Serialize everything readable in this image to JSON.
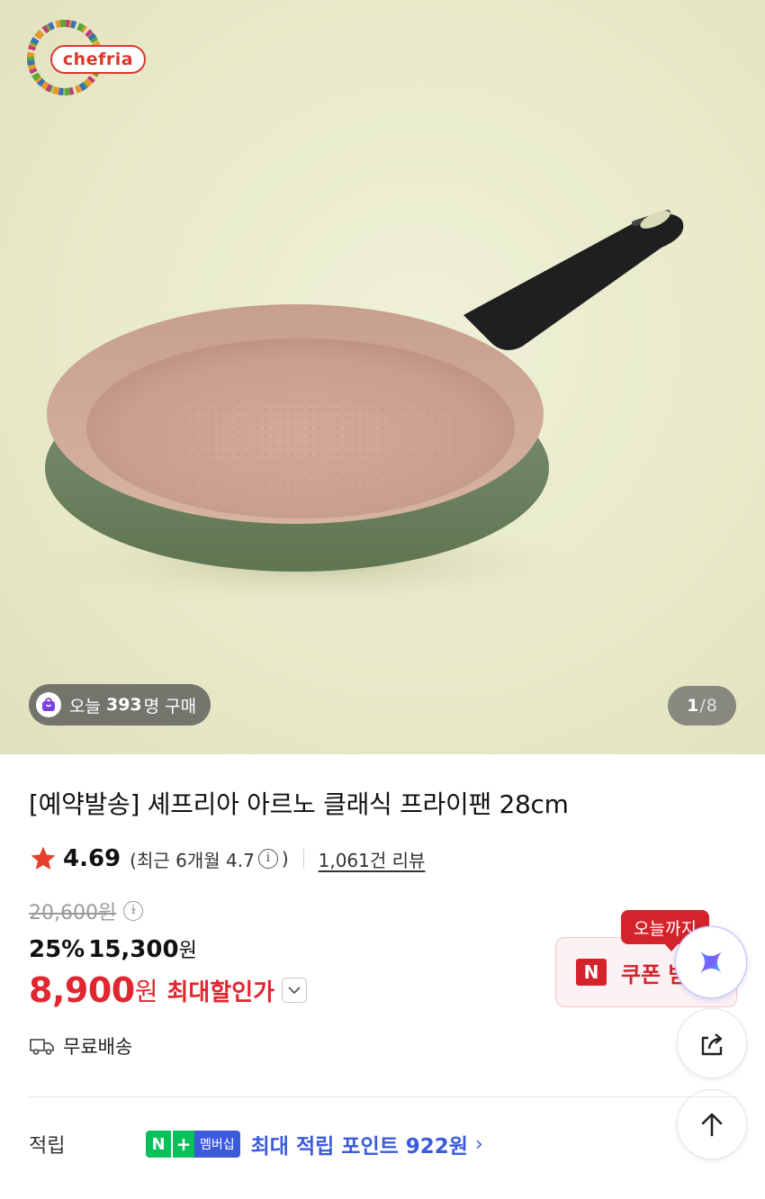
{
  "brand": {
    "logo_text": "chefria"
  },
  "gallery": {
    "today_prefix": "오늘",
    "today_count": "393",
    "today_suffix": "명 구매",
    "current": "1",
    "separator": "/",
    "total": "8"
  },
  "product": {
    "title": "[예약발송] 셰프리아 아르노 클래식 프라이팬 28cm",
    "rating": "4.69",
    "recent_rating_open": "(최근 6개월 4.7",
    "recent_rating_close": ")",
    "review_count": "1,061건 리뷰",
    "original_price": "20,600원",
    "discount_percent": "25%",
    "sale_price": "15,300",
    "sale_currency": "원",
    "best_price": "8,900",
    "best_currency": "원",
    "best_label": "최대할인가"
  },
  "coupon": {
    "tag": "오늘까지",
    "badge": "N",
    "label": "쿠폰 받"
  },
  "shipping": {
    "label": "무료배송"
  },
  "points": {
    "label": "적립",
    "badge_n": "N",
    "badge_plus": "+",
    "badge_membership": "멤버십",
    "text": "최대 적립 포인트 922원",
    "chevron": "›"
  },
  "colors": {
    "accent_red": "#e0262e",
    "coupon_red": "#d3242c",
    "naver_green": "#08c15a",
    "points_blue": "#3b5bdb"
  },
  "icons": [
    "shopping-bag-icon",
    "star-icon",
    "info-icon",
    "chevron-down-icon",
    "truck-icon",
    "share-icon",
    "arrow-up-icon",
    "ai-assistant-icon"
  ]
}
